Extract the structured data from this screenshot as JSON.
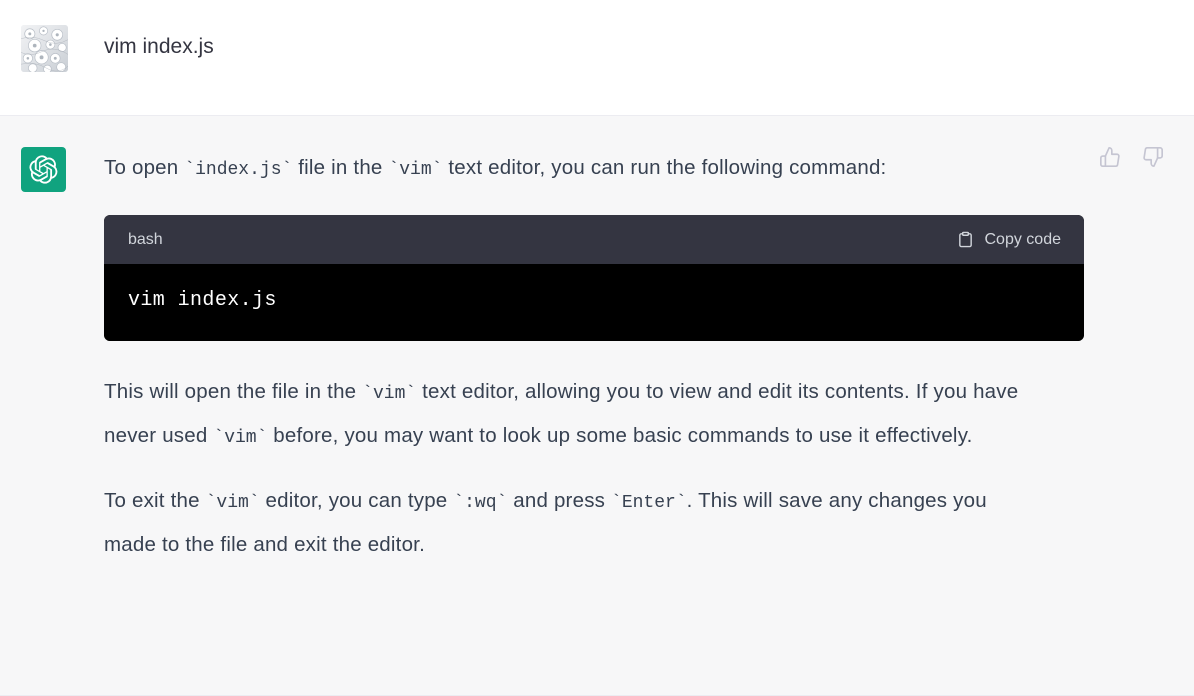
{
  "theme": {
    "user_bg": "#ffffff",
    "assistant_bg": "#f7f7f8",
    "divider": "#ececf1",
    "assistant_avatar_bg": "#10a37f",
    "code_header_bg": "#343541",
    "code_body_bg": "#000000",
    "text_color": "#374151",
    "icon_color": "#c5c5d2"
  },
  "messages": [
    {
      "role": "user",
      "avatar_icon": "user-photo-avatar",
      "text": "vim index.js"
    },
    {
      "role": "assistant",
      "avatar_icon": "openai-logo-icon",
      "paragraph_1": {
        "seg_1": "To open ",
        "code_1": "`index.js`",
        "seg_2": " file in the ",
        "code_2": "`vim`",
        "seg_3": " text editor, you can run the following command:"
      },
      "code_block": {
        "language": "bash",
        "copy_label": "Copy code",
        "copy_icon": "clipboard-icon",
        "code": "vim index.js"
      },
      "paragraph_2": {
        "seg_1": "This will open the file in the ",
        "code_1": "`vim`",
        "seg_2": " text editor, allowing you to view and edit its contents. If you have never used ",
        "code_2": "`vim`",
        "seg_3": " before, you may want to look up some basic commands to use it effectively."
      },
      "paragraph_3": {
        "seg_1": "To exit the ",
        "code_1": "`vim`",
        "seg_2": " editor, you can type ",
        "code_2": "`:wq`",
        "seg_3": " and press ",
        "code_3": "`Enter`",
        "seg_4": ". This will save any changes you made to the file and exit the editor."
      },
      "feedback": {
        "thumbs_up_icon": "thumbs-up-icon",
        "thumbs_down_icon": "thumbs-down-icon"
      }
    }
  ]
}
